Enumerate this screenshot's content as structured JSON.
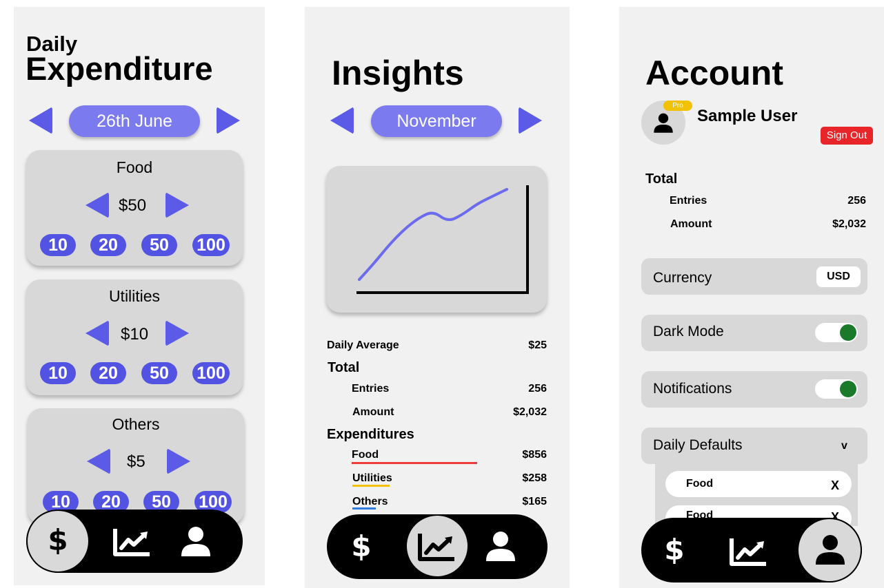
{
  "expenditure": {
    "title_small": "Daily",
    "title_big": "Expenditure",
    "date": "26th June",
    "categories": [
      {
        "name": "Food",
        "amount": "$50",
        "chips": [
          "10",
          "20",
          "50",
          "100"
        ]
      },
      {
        "name": "Utilities",
        "amount": "$10",
        "chips": [
          "10",
          "20",
          "50",
          "100"
        ]
      },
      {
        "name": "Others",
        "amount": "$5",
        "chips": [
          "10",
          "20",
          "50",
          "100"
        ]
      }
    ],
    "nav_dollar": "$"
  },
  "insights": {
    "title": "Insights",
    "month": "November",
    "chart_data": {
      "type": "line",
      "title": "",
      "x": [
        0,
        1,
        2,
        3,
        4,
        5,
        6,
        7,
        8,
        9,
        10
      ],
      "values": [
        0.0,
        0.18,
        0.38,
        0.55,
        0.68,
        0.76,
        0.64,
        0.72,
        0.84,
        0.92,
        1.0
      ],
      "xlabel": "",
      "ylabel": "",
      "grid": false,
      "color": "#6b6bef"
    },
    "daily_average_label": "Daily Average",
    "daily_average_value": "$25",
    "total_label": "Total",
    "entries_label": "Entries",
    "entries_value": "256",
    "amount_label": "Amount",
    "amount_value": "$2,032",
    "expenditures_label": "Expenditures",
    "items": [
      {
        "label": "Food",
        "value": "$856",
        "color": "#ef3b3b"
      },
      {
        "label": "Utilities",
        "value": "$258",
        "color": "#f2c200"
      },
      {
        "label": "Others",
        "value": "$165",
        "color": "#2e7de0"
      }
    ],
    "nav_dollar": "$"
  },
  "account": {
    "title": "Account",
    "pro_badge": "Pro",
    "user_name": "Sample User",
    "sign_out": "Sign Out",
    "total_label": "Total",
    "entries_label": "Entries",
    "entries_value": "256",
    "amount_label": "Amount",
    "amount_value": "$2,032",
    "currency_label": "Currency",
    "currency_value": "USD",
    "dark_mode_label": "Dark Mode",
    "notifications_label": "Notifications",
    "daily_defaults_label": "Daily Defaults",
    "daily_defaults_chevron": "v",
    "defaults": [
      {
        "label": "Food",
        "remove": "X"
      },
      {
        "label": "Food",
        "remove": "X"
      }
    ],
    "nav_dollar": "$"
  },
  "colors": {
    "accent": "#5b5be8",
    "pill": "#7b7bef",
    "chip": "#5353e3",
    "sign_out": "#e8262a",
    "pro": "#f2c200",
    "toggle_on": "#1a7a2a"
  }
}
